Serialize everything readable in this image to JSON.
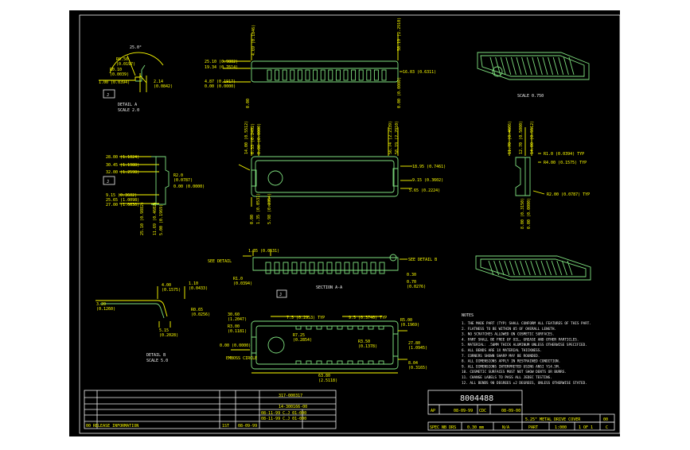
{
  "colors": {
    "page": "#ffffff",
    "sheet": "#000000",
    "line": "#ffff00",
    "frame": "#f2f2f2",
    "body": "#7fe07f",
    "text": "#f2f2f2"
  },
  "views": {
    "detail_a": {
      "angle": "25.0°",
      "r1": "R0.50",
      "r1_in": "(0.0197)",
      "r2": "R0.10",
      "r2_in": "(0.0039)",
      "dim_left": "1.00 (0.0394)",
      "dim_right": "2.14",
      "dim_right_in": "(0.0842)",
      "datum": "J",
      "title": "DETAIL A",
      "scale": "SCALE 2.0"
    },
    "top_view": {
      "d1": "25.10 (0.9882)",
      "d2": "19.34 (0.7614)",
      "d3": "4.87 (0.1917)",
      "d4": "0.00 (0.0000)",
      "d5": "16.03 (0.6311)",
      "v1": "4.69 (0.1846)",
      "v2": "0.00",
      "v3": "58.19 (2.2910)",
      "v4": "0.00 (0.0000)"
    },
    "iso_top": {
      "scale": "SCALE 0.750"
    },
    "front_view": {
      "l1": "28.00 (1.1024)",
      "l2": "30.45 (1.1988)",
      "l3": "32.00 (1.2598)",
      "l4": "0.00 (0.0000)",
      "l5": "9.15 (0.3602)",
      "l6": "25.65 (1.0098)",
      "l7": "27.00 (1.0630)",
      "l8": "25.10 (0.9882)",
      "l9": "11.69 (0.4602)",
      "l10": "5.00 (0.1969)",
      "r1": "R2.0",
      "r1_in": "(0.0787)",
      "r2": "18.95 (0.7461)",
      "r3": "9.15 (0.3602)",
      "r4": "5.65 (0.2224)",
      "t1": "14.00 (0.5512)",
      "t2": "6.33 (0.2492)",
      "t3": "0.00 (0.0000)",
      "t4": "56.74 (2.2339)",
      "t5": "58.19 (2.2910)",
      "b1": "0.00",
      "b2": "1.35 (0.0531)",
      "b3": "5.98 (0.2354)",
      "datum": "J"
    },
    "side_view": {
      "r1": "R1.0 (0.0394) TYP",
      "r2": "R4.00 (0.1575) TYP",
      "r3": "R2.00 (0.0787) TYP",
      "d1": "11.70 (0.4606)",
      "d2": "12.70 (0.5000)",
      "d3": "14.00 (0.5512)",
      "d4": "8.00 (0.3150)",
      "d5": "0.00 (0.0000)"
    },
    "section": {
      "d1": "1.35 (0.0531)",
      "see_detail": "SEE DETAIL",
      "see_detail_b": "SEE DETAIL  B",
      "r": "R1.0",
      "r_in": "(0.0394)",
      "d2": "0.30",
      "d3": "0.70",
      "d3_in": "(0.0276)",
      "label": "SECTION  A-A",
      "datum": "J"
    },
    "detail_b": {
      "d1": "4.00",
      "d1_in": "(0.1575)",
      "d2": "1.10",
      "d2_in": "(0.0433)",
      "d3": "3.20",
      "d3_in": "(0.1260)",
      "r": "R0.65",
      "r_in": "(0.0256)",
      "d4": "5.15",
      "d4_in": "(0.2028)",
      "title": "DETAIL  B",
      "scale": "SCALE  5.0"
    },
    "bottom_view": {
      "d1": "7.5 (0.2953) TYP",
      "d2": "9.5 (0.3740) TYP",
      "d3": "30.60",
      "d3_in": "(1.2047)",
      "r1": "R3.00",
      "r1_in": "(0.1181)",
      "d4": "0.00 (0.0000)",
      "emboss": "EMBOSS CIRCLE",
      "r2": "R7.25",
      "r2_in": "(0.2854)",
      "r3": "R3.50",
      "r3_in": "(0.1378)",
      "r4": "R5.00",
      "r4_in": "(0.1969)",
      "d5": "27.80",
      "d5_in": "(1.0945)",
      "d6": "8.04",
      "d6_in": "(0.3165)",
      "d7": "63.80",
      "d7_in": "(2.5118)"
    }
  },
  "notes": {
    "heading": "NOTES",
    "items": [
      "1. THE MADE PART (TYP) SHALL CONFORM ALL FEATURES OF THIS PART.",
      "2. FLATNESS TO BE WITHIN 05 OF OVERALL LENGTH.",
      "3. NO SCRATCHES ALLOWED ON COSMETIC SURFACES.",
      "4. PART SHALL BE FREE OF OIL, GREASE AND OTHER PARTICLES.",
      "5. MATERIAL: .50MM THICK ALUMINUM UNLESS OTHERWISE SPECIFIED.",
      "6. ALL BENDS ARE 1X MATERIAL THICKNESS.",
      "7. CORNERS SHOWN SHARP MAY BE ROUNDED.",
      "8. ALL DIMENSIONS APPLY IN RESTRAINED CONDITION.",
      "9. ALL DIMENSIONS INTERPRETED USING ANSI Y14.5M.",
      "10. COSMETIC SURFACES MUST NOT SHOW DENTS OR BURRS.",
      "11. CHANGE LABELS TO PASS ALL JEDEC TESTING.",
      "12. ALL BENDS 90 DEGREES ±2 DEGREES, UNLESS OTHERWISE STATED."
    ]
  },
  "title_block": {
    "drawing_number": "8004488",
    "ap_label": "AP",
    "ap_date": "08-09-99",
    "cdc_label": "CDC",
    "cdc_date": "08-09-00",
    "part_desc": "5.25\" METAL DRIVE COVER",
    "rev": "00",
    "spec_label": "SPEC NB DRS",
    "spec_thk": "0.30 mm",
    "spec_na": "N/A",
    "part_label": "PART",
    "qty": "1:000",
    "sheet": "1 OF 1",
    "size": "C"
  },
  "revision_block": {
    "ref1": "317-000317",
    "ref2": "14-300166-00",
    "row_desc": "00  RELEASE INFORMATION",
    "row_code": "1ST",
    "row_date": "08-09-99",
    "sub1": "08-11-99 C.J 01-000",
    "sub2": "08-11-99 C.J 01-000"
  }
}
